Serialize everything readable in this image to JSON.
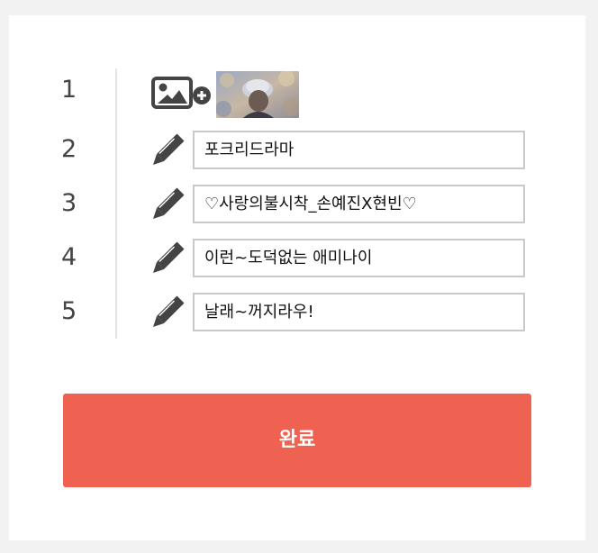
{
  "rows": [
    {
      "number": "1",
      "type": "image",
      "add_icon": "image-add-icon",
      "thumbnail": "person-with-cap-photo"
    },
    {
      "number": "2",
      "type": "text",
      "icon": "pencil-icon",
      "value": "포크리드라마"
    },
    {
      "number": "3",
      "type": "text",
      "icon": "pencil-icon",
      "value": "♡사랑의불시착_손예진X현빈♡"
    },
    {
      "number": "4",
      "type": "text",
      "icon": "pencil-icon",
      "value": "이런~도덕없는 애미나이"
    },
    {
      "number": "5",
      "type": "text",
      "icon": "pencil-icon",
      "value": "날래~꺼지라우!"
    }
  ],
  "done_button": {
    "label": "완료"
  },
  "colors": {
    "accent": "#ef6150",
    "icon": "#444444",
    "field_border": "#c9c9c9",
    "background": "#f2f2f2",
    "card": "#ffffff"
  }
}
